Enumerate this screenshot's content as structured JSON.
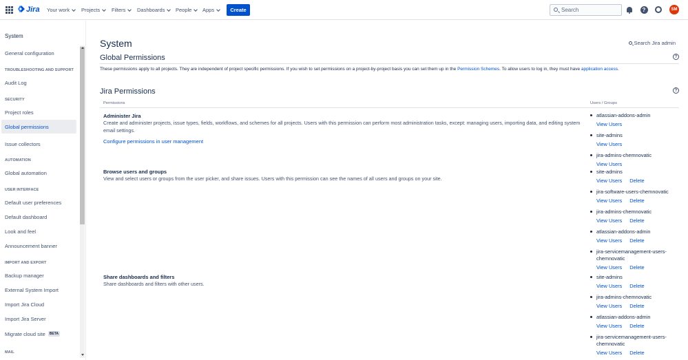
{
  "topnav": {
    "logo_text": "Jira",
    "items": [
      {
        "label": "Your work"
      },
      {
        "label": "Projects"
      },
      {
        "label": "Filters"
      },
      {
        "label": "Dashboards"
      },
      {
        "label": "People"
      },
      {
        "label": "Apps"
      }
    ],
    "create_label": "Create",
    "search_placeholder": "Search",
    "avatar_initials": "SM",
    "avatar_color": "#de350b",
    "brand_color": "#0052cc"
  },
  "sidebar": {
    "title": "System",
    "items": {
      "general": "General configuration",
      "troubleshooting_head": "TROUBLESHOOTING AND SUPPORT",
      "audit": "Audit Log",
      "security_head": "SECURITY",
      "project_roles": "Project roles",
      "global_permissions": "Global permissions",
      "issue_collectors": "Issue collectors",
      "automation_head": "AUTOMATION",
      "global_automation": "Global automation",
      "ui_head": "USER INTERFACE",
      "default_prefs": "Default user preferences",
      "default_dashboard": "Default dashboard",
      "look_feel": "Look and feel",
      "announcement": "Announcement banner",
      "import_head": "IMPORT AND EXPORT",
      "backup": "Backup manager",
      "external_import": "External System Import",
      "import_cloud": "Import Jira Cloud",
      "import_server": "Import Jira Server",
      "migrate": "Migrate cloud site",
      "beta": "BETA",
      "mail_head": "MAIL"
    }
  },
  "main": {
    "title": "System",
    "search_admin": "Search Jira admin",
    "global_heading": "Global Permissions",
    "desc_part1": "These permissions apply to all projects. They are independent of project specific permissions. If you wish to set permissions on a project-by-project basis you can set them up in the",
    "desc_link1": "Permission Schemes",
    "desc_part2": ". To allow users to log in, they must have",
    "desc_link2": "application access",
    "desc_part3": ".",
    "jira_heading": "Jira Permissions",
    "col_permissions": "Permissions",
    "col_groups": "Users / Groups",
    "view_users": "View Users",
    "delete": "Delete",
    "permissions": [
      {
        "name": "Administer Jira",
        "desc": "Create and administer projects, issue types, fields, workflows, and schemes for all projects. Users with this permission can perform most administration tasks, except: managing users, importing data, and editing system email settings.",
        "link": "Configure permissions in user management",
        "groups": [
          "atlassian-addons-admin",
          "site-admins",
          "jira-admins-chemnovatic"
        ]
      },
      {
        "name": "Browse users and groups",
        "desc": "View and select users or groups from the user picker, and share issues. Users with this permission can see the names of all users and groups on your site.",
        "groups": [
          "site-admins",
          "jira-software-users-chemnovatic",
          "jira-admins-chemnovatic",
          "atlassian-addons-admin",
          "jira-servicemanagement-users-chemnovatic"
        ]
      },
      {
        "name": "Share dashboards and filters",
        "desc": "Share dashboards and filters with other users.",
        "groups": [
          "site-admins",
          "jira-admins-chemnovatic",
          "atlassian-addons-admin",
          "jira-servicemanagement-users-chemnovatic"
        ]
      }
    ]
  }
}
